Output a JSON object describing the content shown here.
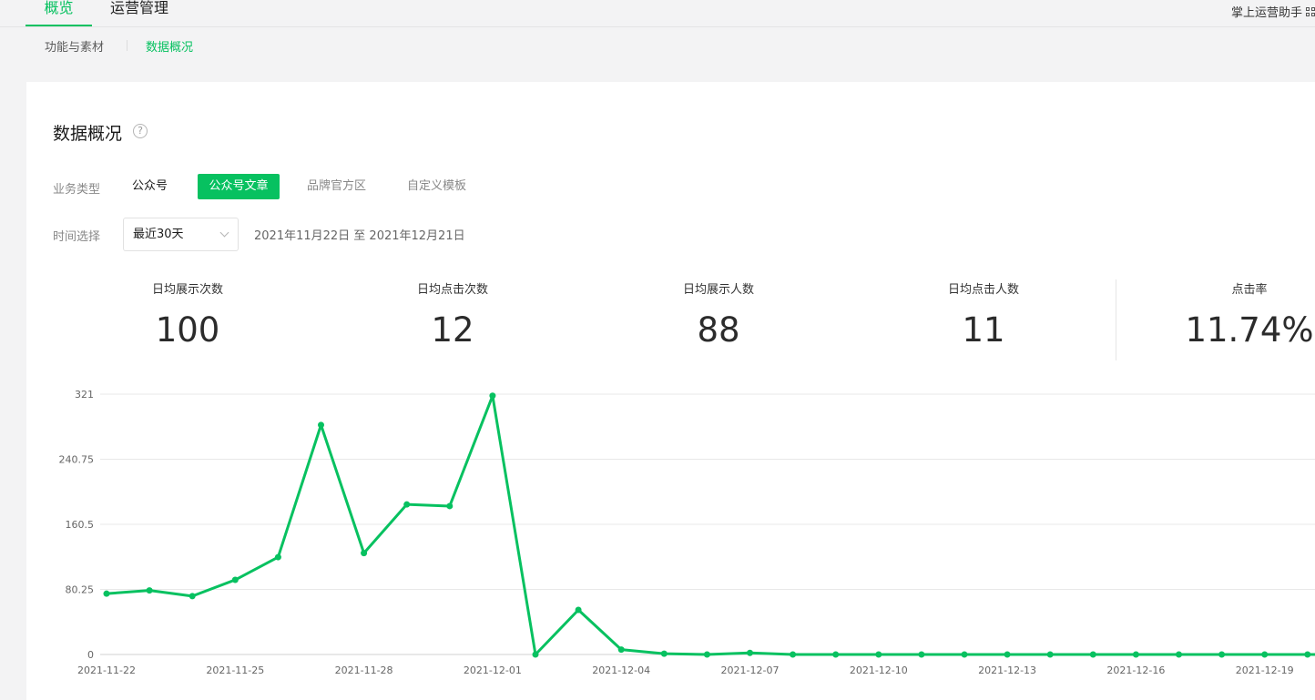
{
  "top_nav": {
    "tabs": [
      {
        "label": "概览",
        "active": true
      },
      {
        "label": "运营管理",
        "active": false
      }
    ],
    "assistant_label": "掌上运营助手"
  },
  "sub_nav": {
    "items": [
      {
        "label": "功能与素材",
        "active": false
      },
      {
        "label": "数据概况",
        "active": true
      }
    ]
  },
  "card": {
    "title": "数据概况",
    "help_icon": "?",
    "business_type": {
      "label": "业务类型",
      "options": [
        "公众号",
        "公众号文章",
        "品牌官方区",
        "自定义模板"
      ],
      "selected": "公众号文章"
    },
    "time_select": {
      "label": "时间选择",
      "value": "最近30天",
      "range_text": "2021年11月22日 至 2021年12月21日"
    }
  },
  "stats": [
    {
      "label": "日均展示次数",
      "value": "100"
    },
    {
      "label": "日均点击次数",
      "value": "12"
    },
    {
      "label": "日均展示人数",
      "value": "88"
    },
    {
      "label": "日均点击人数",
      "value": "11"
    },
    {
      "label": "点击率",
      "value": "11.74%"
    }
  ],
  "colors": {
    "accent": "#07c160"
  },
  "chart_data": {
    "type": "line",
    "x": [
      "2021-11-22",
      "2021-11-23",
      "2021-11-24",
      "2021-11-25",
      "2021-11-26",
      "2021-11-27",
      "2021-11-28",
      "2021-11-29",
      "2021-11-30",
      "2021-12-01",
      "2021-12-02",
      "2021-12-03",
      "2021-12-04",
      "2021-12-05",
      "2021-12-06",
      "2021-12-07",
      "2021-12-08",
      "2021-12-09",
      "2021-12-10",
      "2021-12-11",
      "2021-12-12",
      "2021-12-13",
      "2021-12-14",
      "2021-12-15",
      "2021-12-16",
      "2021-12-17",
      "2021-12-18",
      "2021-12-19",
      "2021-12-20",
      "2021-12-21"
    ],
    "x_tick_labels": [
      "2021-11-22",
      "2021-11-25",
      "2021-11-28",
      "2021-12-01",
      "2021-12-04",
      "2021-12-07",
      "2021-12-10",
      "2021-12-13",
      "2021-12-16",
      "2021-12-19"
    ],
    "series": [
      {
        "values": [
          75,
          79,
          72,
          92,
          120,
          283,
          125,
          185,
          183,
          319,
          0,
          55,
          6,
          1,
          0,
          2,
          0,
          0,
          0,
          0,
          0,
          0,
          0,
          0,
          0,
          0,
          0,
          0,
          0,
          0
        ],
        "color": "#07c160"
      }
    ],
    "y_ticks": [
      0,
      80.25,
      160.5,
      240.75,
      321
    ],
    "ylim": [
      0,
      321
    ],
    "grid": true
  }
}
